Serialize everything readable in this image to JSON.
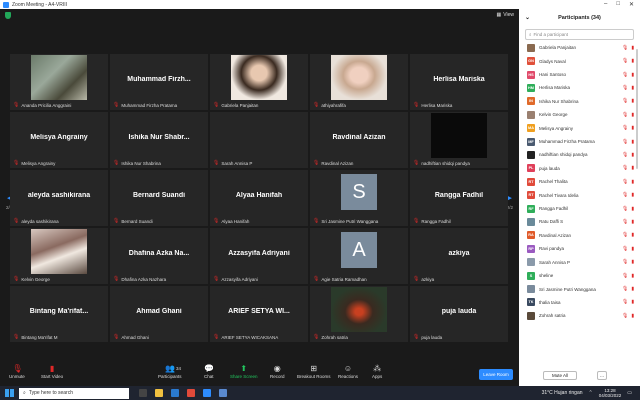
{
  "window": {
    "title": "Zoom Meeting - A4-VRIII"
  },
  "meeting": {
    "view_label": "View",
    "page_left": "2/2",
    "page_right": "2/2"
  },
  "tiles": [
    {
      "big": "",
      "label": "Ananda Pricilia Anggraini",
      "photo": "ph-street"
    },
    {
      "big": "Muhammad Firzh...",
      "label": "Muhammad Firzha Pratama"
    },
    {
      "big": "",
      "label": "Gabriela Panjaitan",
      "photo": "ph-girl1"
    },
    {
      "big": "",
      "label": "athiyahrafifa",
      "photo": "ph-girl2"
    },
    {
      "big": "Herlisa Mariska",
      "label": "Herlisa Mariska"
    },
    {
      "big": "Melisya Angrainy",
      "label": "Melisya Angrainy"
    },
    {
      "big": "Ishika Nur Shabr...",
      "label": "Ishika Nur Shabrina"
    },
    {
      "big": "",
      "label": "Sarah Annisa P"
    },
    {
      "big": "Ravdinal Azizan",
      "label": "Ravdinal Azizan"
    },
    {
      "big": "",
      "label": "nadhiftian shidqi pandya",
      "photo": "ph-dark"
    },
    {
      "big": "aleyda sashikirana",
      "label": "aleyda sashikirana"
    },
    {
      "big": "Bernard Suandi",
      "label": "Bernard Suandi"
    },
    {
      "big": "Alyaa Hanifah",
      "label": "Alyaa Hanifah"
    },
    {
      "big": "",
      "label": "Sri Jasmine Putri Wanggana",
      "avatar": "S"
    },
    {
      "big": "Rangga Fadhil",
      "label": "Rangga Fadhil"
    },
    {
      "big": "",
      "label": "Kelvin George",
      "photo": "ph-anime"
    },
    {
      "big": "Dhafina Azka Na...",
      "label": "Dhafina Azka Nazhara"
    },
    {
      "big": "Azzasyifa Adriyani",
      "label": "Azzasyifa Adriyani"
    },
    {
      "big": "",
      "label": "Agie Satria Ramadhan",
      "avatar": "A"
    },
    {
      "big": "azkiya",
      "label": "azkiya"
    },
    {
      "big": "Bintang Ma'rifat...",
      "label": "Bintang Ma'rifat M"
    },
    {
      "big": "Ahmad Ghani",
      "label": "Ahmad Ghani"
    },
    {
      "big": "ARIEF SETYA WI...",
      "label": "ARIEF SETYA WICAKSANA"
    },
    {
      "big": "",
      "label": "Zohrah satria",
      "photo": "ph-moto"
    },
    {
      "big": "puja lauda",
      "label": "puja lauda"
    }
  ],
  "toolbar": {
    "unmute": "Unmute",
    "start_video": "Start Video",
    "participants": "Participants",
    "participants_count": "34",
    "chat": "Chat",
    "share_screen": "Share Screen",
    "record": "Record",
    "breakout": "Breakout Rooms",
    "reactions": "Reactions",
    "apps": "Apps",
    "leave": "Leave Room"
  },
  "panel": {
    "title": "Participants (34)",
    "search_placeholder": "Find a participant",
    "mute_all": "Mute All",
    "more": "...",
    "participants": [
      {
        "name": "Gabriela Panjaitan",
        "initials": "",
        "color": "#8a6a50"
      },
      {
        "name": "Gladys Naval",
        "initials": "GN",
        "color": "#e0503a"
      },
      {
        "name": "Hani Santoso",
        "initials": "HS",
        "color": "#e04a6a"
      },
      {
        "name": "Herlisa Mariska",
        "initials": "HM",
        "color": "#2fae5a"
      },
      {
        "name": "Ishika Nur Shabrina",
        "initials": "IN",
        "color": "#e06a2a"
      },
      {
        "name": "Kelvin George",
        "initials": "",
        "color": "#9a8070"
      },
      {
        "name": "Melisya Angrainy",
        "initials": "MA",
        "color": "#f0a020"
      },
      {
        "name": "Muhammad Firzha Pratama",
        "initials": "MF",
        "color": "#4a5a70"
      },
      {
        "name": "nadhiftian shidqi pandya",
        "initials": "",
        "color": "#222222"
      },
      {
        "name": "puja lauda",
        "initials": "PL",
        "color": "#e0405a"
      },
      {
        "name": "Rachel Thalita",
        "initials": "RT",
        "color": "#e04a3a"
      },
      {
        "name": "Rachel Tivara Idelia",
        "initials": "RT",
        "color": "#e04a3a"
      },
      {
        "name": "Rangga Fadhil",
        "initials": "RF",
        "color": "#2fae5a"
      },
      {
        "name": "Ratu Daffi S",
        "initials": "",
        "color": "#6a8a9a"
      },
      {
        "name": "Ravdinal Azizan",
        "initials": "RA",
        "color": "#e05a2a"
      },
      {
        "name": "Ravi pandya",
        "initials": "RP",
        "color": "#9a5ac0"
      },
      {
        "name": "Sarah Annisa P",
        "initials": "",
        "color": "#8a9aaa"
      },
      {
        "name": "sheline",
        "initials": "S",
        "color": "#2fae5a"
      },
      {
        "name": "Sri Jasmine Putri Wanggana",
        "initials": "",
        "color": "#7a8b9c"
      },
      {
        "name": "thalia taisa",
        "initials": "TK",
        "color": "#3a4a60"
      },
      {
        "name": "Zohrah satria",
        "initials": "",
        "color": "#5a4a3a"
      }
    ]
  },
  "taskbar": {
    "search_placeholder": "Type here to search",
    "weather": "31°C Hujan ringan",
    "time": "13:28",
    "date": "04/03/2022"
  }
}
